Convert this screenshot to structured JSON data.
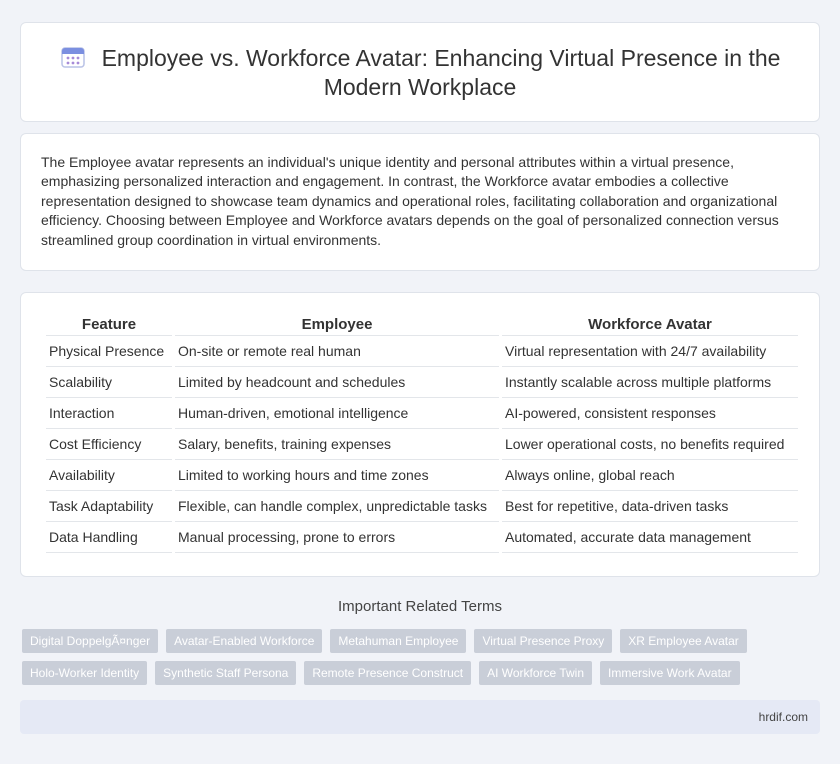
{
  "header": {
    "title": "Employee vs. Workforce Avatar: Enhancing Virtual Presence in the Modern Workplace",
    "icon": "calendar-icon"
  },
  "intro": {
    "text": "The Employee avatar represents an individual's unique identity and personal attributes within a virtual presence, emphasizing personalized interaction and engagement. In contrast, the Workforce avatar embodies a collective representation designed to showcase team dynamics and operational roles, facilitating collaboration and organizational efficiency. Choosing between Employee and Workforce avatars depends on the goal of personalized connection versus streamlined group coordination in virtual environments."
  },
  "table": {
    "headers": [
      "Feature",
      "Employee",
      "Workforce Avatar"
    ],
    "rows": [
      [
        "Physical Presence",
        "On-site or remote real human",
        "Virtual representation with 24/7 availability"
      ],
      [
        "Scalability",
        "Limited by headcount and schedules",
        "Instantly scalable across multiple platforms"
      ],
      [
        "Interaction",
        "Human-driven, emotional intelligence",
        "AI-powered, consistent responses"
      ],
      [
        "Cost Efficiency",
        "Salary, benefits, training expenses",
        "Lower operational costs, no benefits required"
      ],
      [
        "Availability",
        "Limited to working hours and time zones",
        "Always online, global reach"
      ],
      [
        "Task Adaptability",
        "Flexible, can handle complex, unpredictable tasks",
        "Best for repetitive, data-driven tasks"
      ],
      [
        "Data Handling",
        "Manual processing, prone to errors",
        "Automated, accurate data management"
      ]
    ]
  },
  "related": {
    "title": "Important Related Terms",
    "tags": [
      "Digital DoppelgÃ¤nger",
      "Avatar-Enabled Workforce",
      "Metahuman Employee",
      "Virtual Presence Proxy",
      "XR Employee Avatar",
      "Holo-Worker Identity",
      "Synthetic Staff Persona",
      "Remote Presence Construct",
      "AI Workforce Twin",
      "Immersive Work Avatar"
    ]
  },
  "footer": {
    "site": "hrdif.com"
  },
  "colors": {
    "tag_bg": "#c9ced8",
    "footer_bg": "#e5e9f5",
    "page_bg": "#f1f3f8"
  }
}
